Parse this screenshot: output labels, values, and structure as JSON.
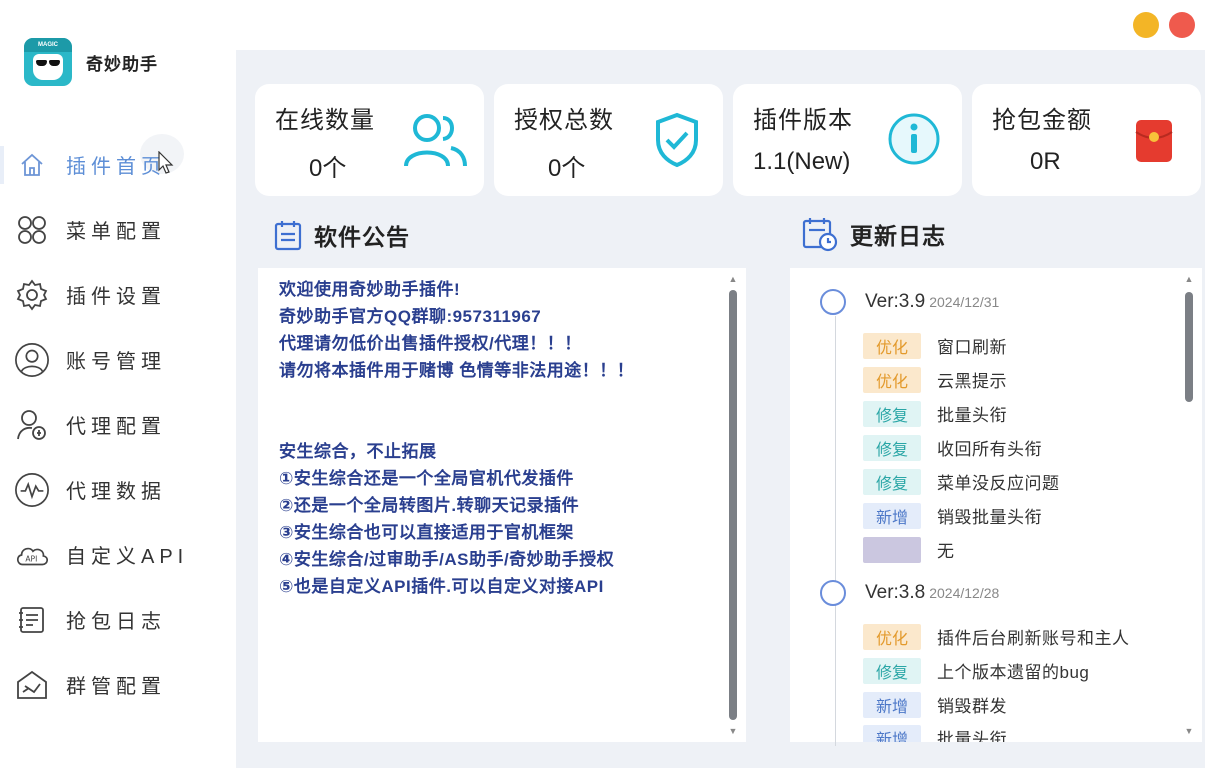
{
  "app": {
    "name": "奇妙助手",
    "logo_caption": "MAGIC"
  },
  "nav": [
    {
      "label": "插件首页",
      "icon": "home-icon",
      "active": true
    },
    {
      "label": "菜单配置",
      "icon": "grid-icon"
    },
    {
      "label": "插件设置",
      "icon": "gear-icon"
    },
    {
      "label": "账号管理",
      "icon": "user-circle-icon"
    },
    {
      "label": "代理配置",
      "icon": "agent-icon"
    },
    {
      "label": "代理数据",
      "icon": "pulse-icon"
    },
    {
      "label": "自定义API",
      "icon": "api-cloud-icon"
    },
    {
      "label": "抢包日志",
      "icon": "log-icon"
    },
    {
      "label": "群管配置",
      "icon": "group-manage-icon"
    }
  ],
  "stats": [
    {
      "title": "在线数量",
      "value": "0个",
      "icon": "users-icon",
      "color": "#1fb8d6"
    },
    {
      "title": "授权总数",
      "value": "0个",
      "icon": "shield-check-icon",
      "color": "#1fb8d6"
    },
    {
      "title": "插件版本",
      "value": "1.1(New)",
      "icon": "info-icon",
      "color": "#1fb8d6"
    },
    {
      "title": "抢包金额",
      "value": "0R",
      "icon": "red-envelope-icon",
      "color": "#e53b2f"
    }
  ],
  "announcement": {
    "title": "软件公告",
    "lines": [
      "欢迎使用奇妙助手插件!",
      "奇妙助手官方QQ群聊:957311967",
      "代理请勿低价出售插件授权/代理！！！",
      "请勿将本插件用于赌博 色情等非法用途！！！",
      "",
      "安生综合，不止拓展",
      "①安生综合还是一个全局官机代发插件",
      "②还是一个全局转图片.转聊天记录插件",
      "③安生综合也可以直接适用于官机框架",
      "④安生综合/过审助手/AS助手/奇妙助手授权",
      "⑤也是自定义API插件.可以自定义对接API"
    ]
  },
  "changelog": {
    "title": "更新日志",
    "versions": [
      {
        "version": "Ver:3.9",
        "date": "2024/12/31",
        "entries": [
          {
            "tag": "优化",
            "type": "opt",
            "text": "窗口刷新"
          },
          {
            "tag": "优化",
            "type": "opt",
            "text": "云黑提示"
          },
          {
            "tag": "修复",
            "type": "fix",
            "text": "批量头衔"
          },
          {
            "tag": "修复",
            "type": "fix",
            "text": "收回所有头衔"
          },
          {
            "tag": "修复",
            "type": "fix",
            "text": "菜单没反应问题"
          },
          {
            "tag": "新增",
            "type": "new",
            "text": "销毁批量头衔"
          },
          {
            "tag": "",
            "type": "none",
            "text": "无"
          }
        ]
      },
      {
        "version": "Ver:3.8",
        "date": "2024/12/28",
        "entries": [
          {
            "tag": "优化",
            "type": "opt",
            "text": "插件后台刷新账号和主人"
          },
          {
            "tag": "修复",
            "type": "fix",
            "text": "上个版本遗留的bug"
          },
          {
            "tag": "新增",
            "type": "new",
            "text": "销毁群发"
          },
          {
            "tag": "新增",
            "type": "new",
            "text": "批量头衔"
          }
        ]
      }
    ]
  }
}
